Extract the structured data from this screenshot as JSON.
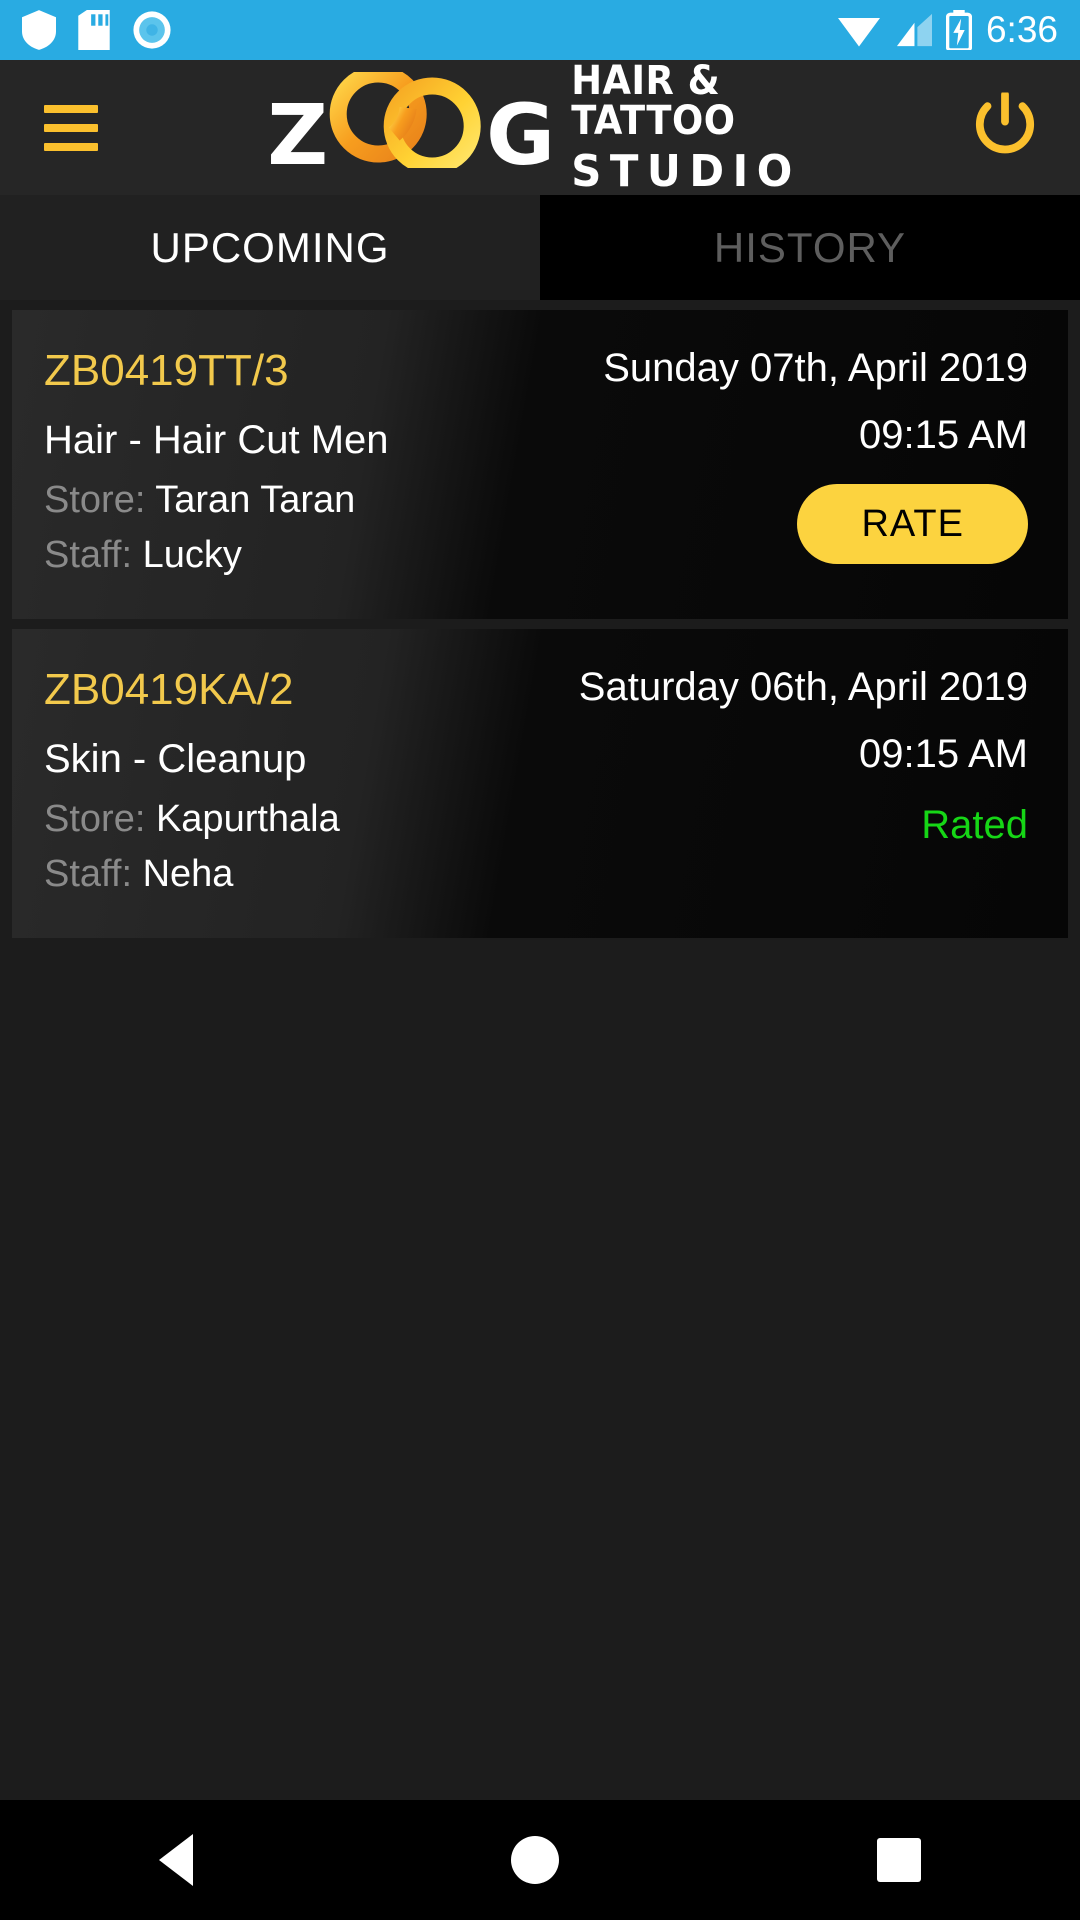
{
  "status_bar": {
    "time": "6:36",
    "left_icons": [
      "shield-icon",
      "sd-card-icon",
      "location-icon"
    ],
    "right_icons": [
      "wifi-icon",
      "signal-icon",
      "battery-charging-icon"
    ],
    "background_color": "#29ABE2"
  },
  "app_bar": {
    "menu_icon": "hamburger-menu-icon",
    "power_icon": "power-icon",
    "logo": {
      "letter_start": "Z",
      "letter_end": "G",
      "rings": "two-interlocking-rings",
      "tagline_line1": "HAIR & TATTOO",
      "tagline_line2": "STUDIO",
      "accent_color": "#FBC02D"
    }
  },
  "tabs": [
    {
      "label": "UPCOMING",
      "active": true
    },
    {
      "label": "HISTORY",
      "active": false
    }
  ],
  "appointments": [
    {
      "code": "ZB0419TT/3",
      "service": "Hair - Hair Cut Men",
      "store_label": "Store:",
      "store_value": "Taran Taran",
      "staff_label": "Staff:",
      "staff_value": "Lucky",
      "date": "Sunday 07th, April 2019",
      "time": "09:15 AM",
      "action_type": "button",
      "action_label": "RATE"
    },
    {
      "code": "ZB0419KA/2",
      "service": "Skin - Cleanup",
      "store_label": "Store:",
      "store_value": "Kapurthala",
      "staff_label": "Staff:",
      "staff_value": "Neha",
      "date": "Saturday 06th, April 2019",
      "time": "09:15 AM",
      "action_type": "status",
      "action_label": "Rated"
    }
  ],
  "nav_bar": {
    "back": "back-triangle-icon",
    "home": "home-circle-icon",
    "recents": "recents-square-icon"
  },
  "colors": {
    "accent_yellow": "#F2C94C",
    "button_yellow": "#FCD33F",
    "rated_green": "#16D616",
    "status_blue": "#29ABE2"
  }
}
